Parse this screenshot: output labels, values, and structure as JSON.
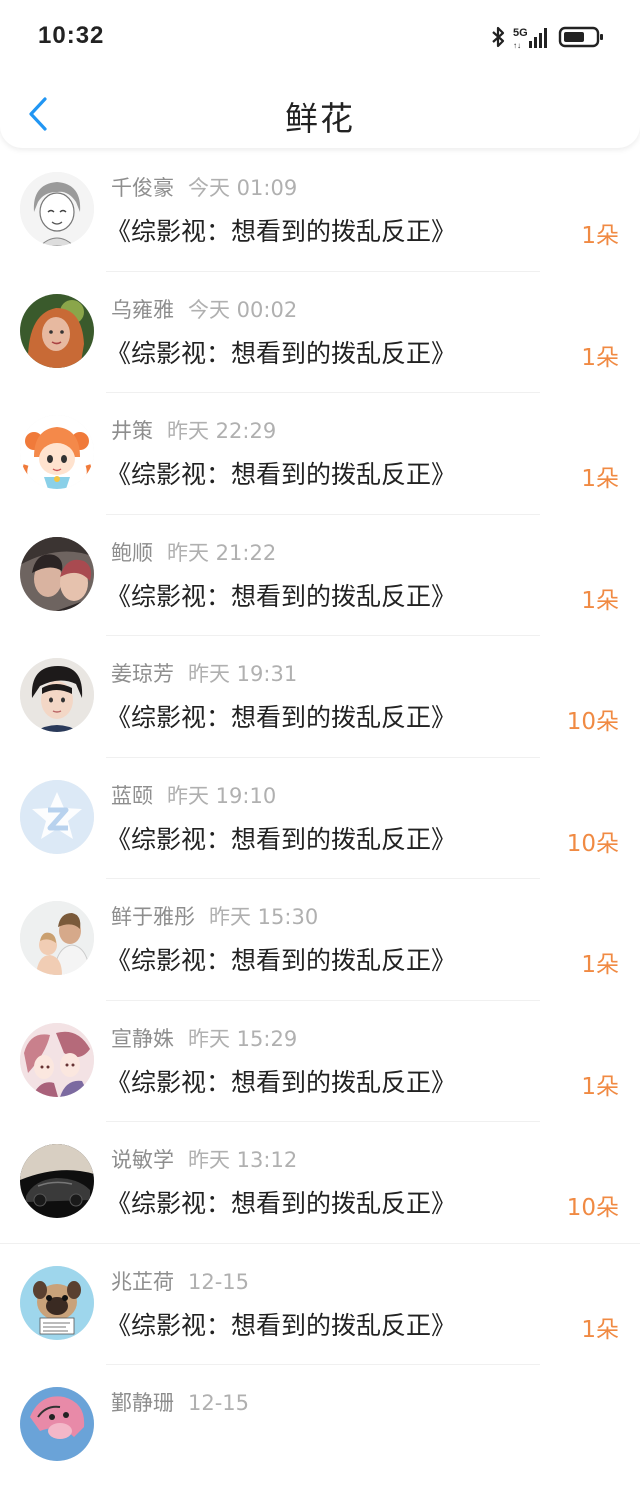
{
  "status_bar": {
    "time": "10:32",
    "network": "5G",
    "icons": [
      "bluetooth-icon",
      "signal-icon",
      "battery-icon"
    ]
  },
  "header": {
    "title": "鲜花",
    "back_icon": "chevron-left-icon"
  },
  "colors": {
    "accent": "#2196f3",
    "flower_count": "#f08a43",
    "name": "#8e8e8e",
    "time": "#b0b0b0"
  },
  "items": [
    {
      "name": "千俊豪",
      "time": "今天 01:09",
      "book": "《综影视：想看到的拨乱反正》",
      "count": "1朵"
    },
    {
      "name": "乌雍雅",
      "time": "今天 00:02",
      "book": "《综影视：想看到的拨乱反正》",
      "count": "1朵"
    },
    {
      "name": "井策",
      "time": "昨天 22:29",
      "book": "《综影视：想看到的拨乱反正》",
      "count": "1朵"
    },
    {
      "name": "鲍顺",
      "time": "昨天 21:22",
      "book": "《综影视：想看到的拨乱反正》",
      "count": "1朵"
    },
    {
      "name": "姜琼芳",
      "time": "昨天 19:31",
      "book": "《综影视：想看到的拨乱反正》",
      "count": "10朵"
    },
    {
      "name": "蓝颐",
      "time": "昨天 19:10",
      "book": "《综影视：想看到的拨乱反正》",
      "count": "10朵"
    },
    {
      "name": "鲜于雅彤",
      "time": "昨天 15:30",
      "book": "《综影视：想看到的拨乱反正》",
      "count": "1朵"
    },
    {
      "name": "宣静姝",
      "time": "昨天 15:29",
      "book": "《综影视：想看到的拨乱反正》",
      "count": "1朵"
    },
    {
      "name": "说敏学",
      "time": "昨天 13:12",
      "book": "《综影视：想看到的拨乱反正》",
      "count": "10朵"
    },
    {
      "name": "兆芷荷",
      "time": "12-15",
      "book": "《综影视：想看到的拨乱反正》",
      "count": "1朵"
    },
    {
      "name": "鄞静珊",
      "time": "12-15",
      "book": "",
      "count": ""
    }
  ]
}
